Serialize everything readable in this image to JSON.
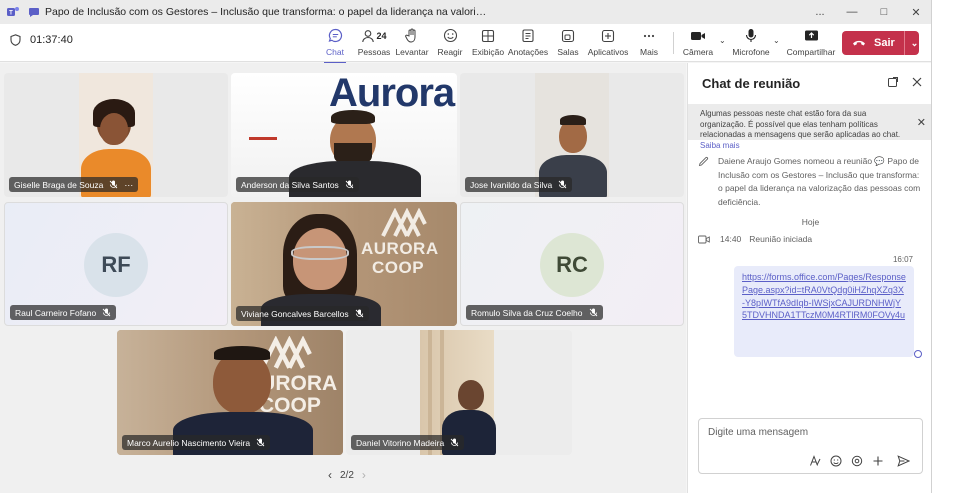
{
  "window": {
    "title": "Papo de Inclusão com os Gestores – Inclusão que transforma: o papel da liderança na valorização das pessoas com de...",
    "controls": [
      "...",
      "—",
      "□",
      "✕"
    ]
  },
  "toolbar": {
    "timer": "01:37:40",
    "buttons": {
      "chat": "Chat",
      "people": "Pessoas",
      "people_count": "24",
      "raise": "Levantar",
      "react": "Reagir",
      "view": "Exibição",
      "notes": "Anotações",
      "rooms": "Salas",
      "apps": "Aplicativos",
      "more": "Mais",
      "camera": "Câmera",
      "mic": "Microfone",
      "share": "Compartilhar"
    },
    "leave_label": "Sair",
    "leave_color": "#c4314b",
    "accent_color": "#5b5fc7"
  },
  "stage": {
    "participants": [
      {
        "name": "Giselle Braga de Souza"
      },
      {
        "name": "Anderson da Silva Santos",
        "background_text": "Aurora"
      },
      {
        "name": "Jose Ivanildo da Silva"
      },
      {
        "name": "Raul Carneiro Fofano",
        "initials": "RF"
      },
      {
        "name": "Viviane Goncalves Barcellos",
        "background_text_1": "AURORA",
        "background_text_2": "COOP"
      },
      {
        "name": "Romulo Silva da Cruz Coelho",
        "initials": "RC"
      },
      {
        "name": "Marco Aurelio Nascimento Vieira",
        "background_text_1": "AURORA",
        "background_text_2": "COOP"
      },
      {
        "name": "Daniel Vitorino Madeira"
      }
    ],
    "pager": "2/2"
  },
  "chat": {
    "title": "Chat de reunião",
    "notice": "Algumas pessoas neste chat estão fora da sua organização. É possível que elas tenham políticas relacionadas a mensagens que serão aplicadas ao chat.",
    "notice_link": "Saiba mais",
    "system_message": "Daiene Araujo Gomes nomeou a reunião 💬 Papo de Inclusão com os Gestores – Inclusão que transforma: o papel da liderança na valorização das pessoas com deficiência.",
    "date_separator": "Hoje",
    "meeting_started_time": "14:40",
    "meeting_started_text": "Reunião iniciada",
    "message_time": "16:07",
    "message_link": "https://forms.office.com/Pages/ResponsePage.aspx?id=tRA0VtQdg0iHZhqXZq3X-Y8pIWTfA9dIqb-IWSjxCAJURDNHWjY5TDVHNDA1TTczM0M4RTlRM0FOVy4u",
    "compose_placeholder": "Digite uma mensagem"
  }
}
